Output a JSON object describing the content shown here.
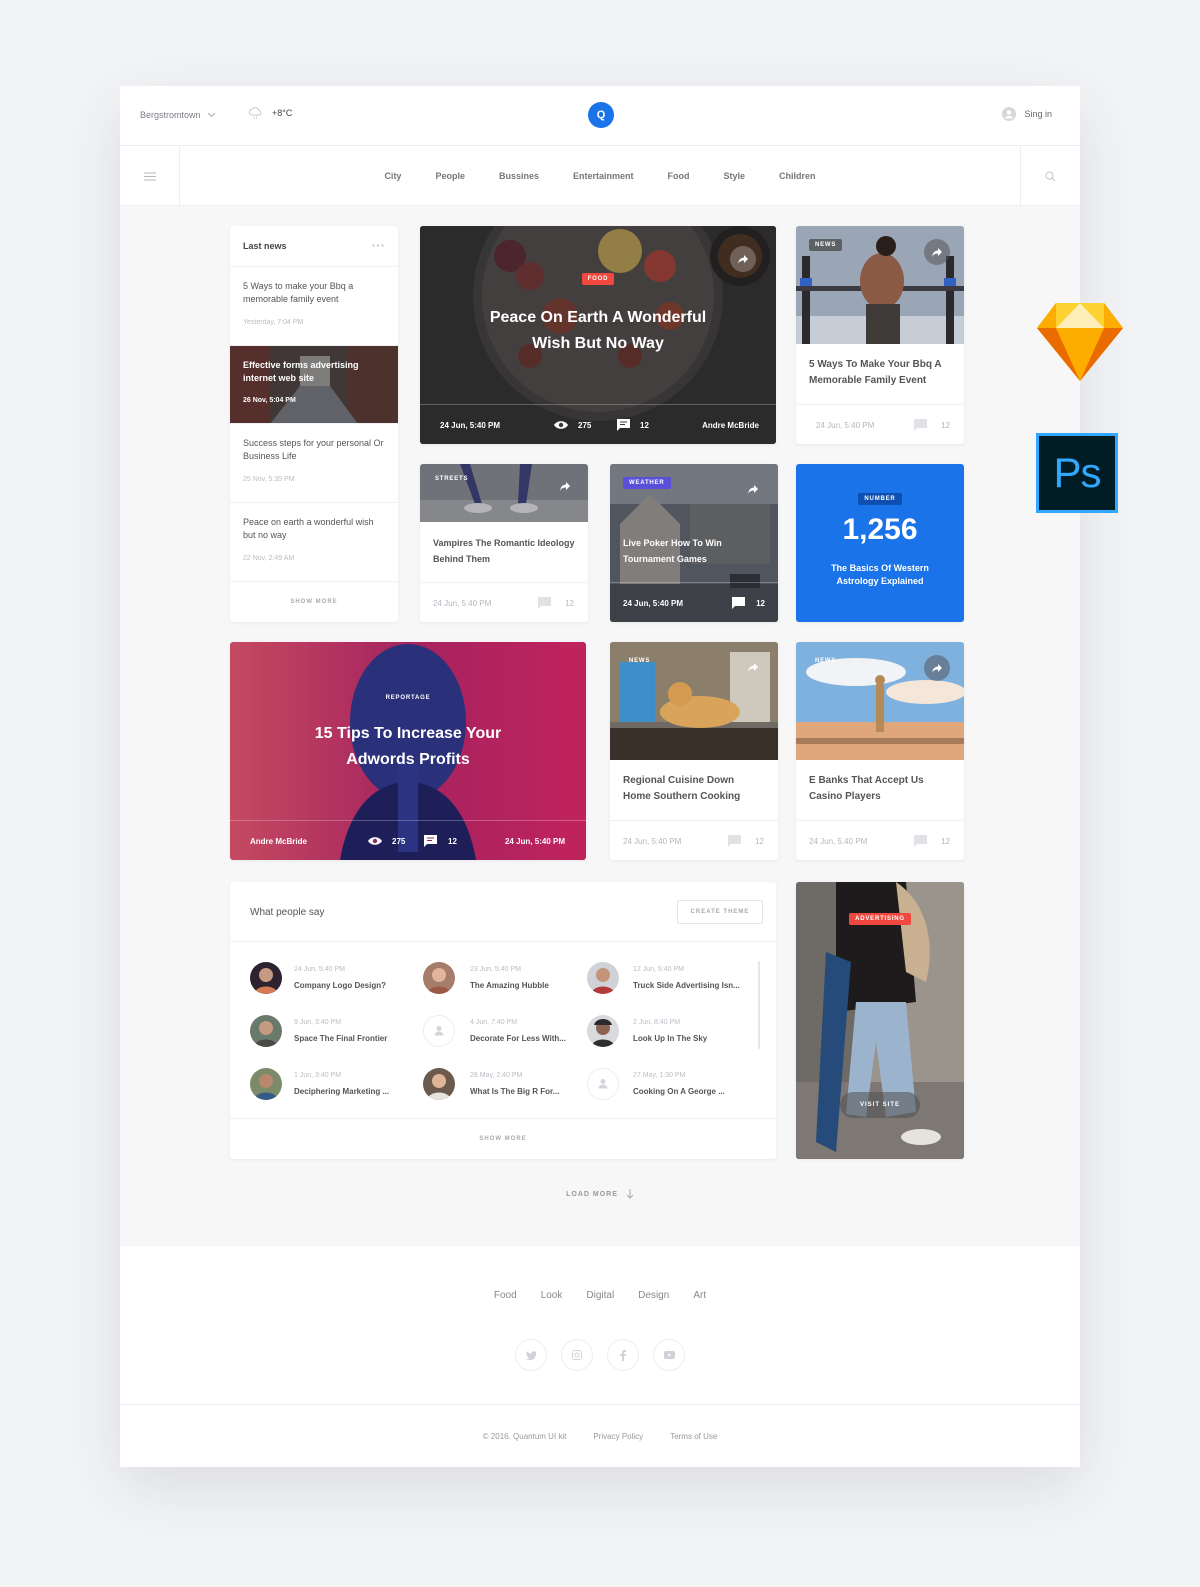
{
  "header": {
    "location": "Bergstromtown",
    "temperature": "+8°C",
    "logo_letter": "Q",
    "signin": "Sing in"
  },
  "nav": {
    "items": [
      "City",
      "People",
      "Bussines",
      "Entertainment",
      "Food",
      "Style",
      "Children"
    ]
  },
  "last_news": {
    "title": "Last news",
    "items": [
      {
        "title": "5 Ways to make your Bbq a memorable family event",
        "date": "Yesterday, 7:04 PM"
      },
      {
        "title": "Effective forms advertising internet web site",
        "date": "26 Nov, 5:04 PM"
      },
      {
        "title": "Success steps for your personal Or Business Life",
        "date": "25 Nov, 5:35 PM"
      },
      {
        "title": "Peace on earth a wonderful wish but no way",
        "date": "22 Nov, 2:49 AM"
      }
    ],
    "show_more": "SHOW MORE"
  },
  "hero": {
    "badge": "FOOD",
    "title": "Peace On Earth A Wonderful Wish But No Way",
    "date": "24 Jun, 5:40 PM",
    "views": "275",
    "comments": "12",
    "author": "Andre McBride"
  },
  "card_bbq": {
    "badge": "NEWS",
    "title": "5 Ways To Make Your Bbq A Memorable Family Event",
    "date": "24 Jun, 5:40 PM",
    "comments": "12"
  },
  "card_vampires": {
    "badge": "STREETS",
    "title": "Vampires The Romantic Ideology Behind Them",
    "date": "24 Jun, 5:40 PM",
    "comments": "12"
  },
  "card_poker": {
    "badge": "WEATHER",
    "title": "Live Poker How To Win Tournament Games",
    "date": "24 Jun, 5:40 PM",
    "comments": "12"
  },
  "card_number": {
    "badge": "NUMBER",
    "value": "1,256",
    "title": "The Basics Of Western Astrology Explained"
  },
  "card_reportage": {
    "badge": "REPORTAGE",
    "title": "15 Tips To Increase Your Adwords Profits",
    "author": "Andre McBride",
    "views": "275",
    "comments": "12",
    "date": "24 Jun, 5:40 PM"
  },
  "card_cuisine": {
    "badge": "NEWS",
    "title": "Regional Cuisine Down Home Southern Cooking",
    "date": "24 Jun, 5:40 PM",
    "comments": "12"
  },
  "card_banks": {
    "badge": "NEWS",
    "title": "E Banks That Accept Us Casino Players",
    "date": "24 Jun, 5:40 PM",
    "comments": "12"
  },
  "people_say": {
    "title": "What people say",
    "button": "CREATE THEME",
    "items": [
      {
        "date": "24 Jun, 5:40 PM",
        "title": "Company Logo Design?"
      },
      {
        "date": "23 Jun, 5:40 PM",
        "title": "The Amazing Hubble"
      },
      {
        "date": "12 Jun, 5:40 PM",
        "title": "Truck Side Advertising Isn..."
      },
      {
        "date": "9 Jun, 3:40 PM",
        "title": "Space The Final Frontier"
      },
      {
        "date": "4 Jun, 7:40 PM",
        "title": "Decorate For Less With..."
      },
      {
        "date": "2 Jun, 8:40 PM",
        "title": "Look Up In The Sky"
      },
      {
        "date": "1 Jun, 3:40 PM",
        "title": "Deciphering Marketing ..."
      },
      {
        "date": "28 May, 2:40 PM",
        "title": "What Is The Big R For..."
      },
      {
        "date": "27 May, 1:30 PM",
        "title": "Cooking On A George ..."
      }
    ],
    "show_more": "SHOW MORE"
  },
  "advertising": {
    "badge": "ADVERTISING",
    "button": "VISIT SITE"
  },
  "load_more": "LOAD MORE",
  "footer": {
    "links": [
      "Food",
      "Look",
      "Digital",
      "Design",
      "Art"
    ],
    "copyright": "© 2016. Quantum UI kit",
    "privacy": "Privacy Policy",
    "terms": "Terms of Use"
  },
  "side_icons": {
    "sketch": "sketch-icon",
    "ps_label": "Ps"
  },
  "colors": {
    "accent": "#1a73e8",
    "red": "#f0483e",
    "purple": "#5a4fd8",
    "ps_bg": "#001d26",
    "ps_text": "#31a8ff"
  }
}
